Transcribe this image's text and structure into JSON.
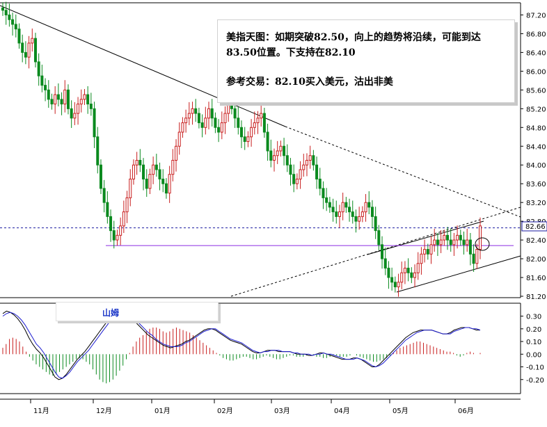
{
  "annotation": {
    "line1": "美指天图：如期突破82.50，向上的趋势将沿续，可能到达83.50位置。下支持在82.10",
    "line2": "参考交易：82.10买入美元，沽出非美"
  },
  "indicator_label": "山姆",
  "chart_data": [
    {
      "type": "candlestick",
      "title": "",
      "xlabel": "",
      "ylabel": "",
      "ylim": [
        81.2,
        87.4
      ],
      "y_ticks": [
        "87.20",
        "86.80",
        "86.40",
        "86.00",
        "85.60",
        "85.20",
        "84.80",
        "84.40",
        "84.00",
        "83.60",
        "83.20",
        "82.80",
        "82.40",
        "82.00",
        "81.60",
        "81.20"
      ],
      "x_ticks": [
        "11月",
        "12月",
        "01月",
        "02月",
        "03月",
        "04月",
        "05月",
        "06月"
      ],
      "current_price": "82.66",
      "horizontal_levels": [
        {
          "value": 82.66,
          "style": "dashed",
          "color": "#1a1aa0"
        },
        {
          "value": 82.28,
          "style": "solid",
          "color": "#8a2be2"
        }
      ],
      "closes": [
        87.3,
        87.2,
        87.1,
        87.0,
        86.9,
        86.6,
        86.4,
        86.3,
        86.6,
        86.7,
        86.2,
        85.9,
        85.7,
        85.6,
        85.4,
        85.3,
        85.5,
        85.4,
        85.3,
        85.6,
        85.2,
        85.0,
        85.1,
        85.3,
        85.4,
        85.5,
        85.3,
        85.2,
        84.6,
        84.0,
        83.5,
        83.2,
        82.9,
        82.6,
        82.4,
        82.5,
        82.7,
        83.0,
        83.3,
        83.7,
        84.0,
        84.1,
        84.0,
        83.7,
        83.5,
        83.8,
        84.0,
        83.9,
        83.7,
        83.6,
        83.4,
        83.8,
        84.1,
        84.4,
        84.7,
        84.9,
        85.0,
        85.1,
        85.2,
        85.1,
        84.9,
        84.8,
        85.0,
        85.2,
        85.0,
        84.8,
        84.7,
        84.9,
        85.1,
        85.3,
        85.2,
        85.0,
        84.8,
        84.6,
        84.5,
        84.6,
        84.8,
        84.9,
        85.0,
        85.1,
        84.7,
        84.3,
        84.1,
        84.2,
        84.3,
        84.4,
        84.2,
        84.0,
        83.8,
        83.6,
        83.7,
        83.9,
        84.0,
        84.1,
        84.2,
        84.0,
        83.7,
        83.5,
        83.3,
        83.2,
        83.1,
        83.0,
        82.9,
        83.0,
        83.2,
        83.1,
        83.0,
        82.9,
        82.8,
        82.9,
        83.0,
        83.2,
        83.1,
        82.9,
        82.6,
        82.3,
        82.0,
        81.8,
        81.6,
        81.5,
        81.4,
        81.5,
        81.7,
        81.8,
        81.7,
        81.6,
        81.7,
        81.9,
        82.1,
        82.2,
        82.1,
        82.3,
        82.4,
        82.3,
        82.4,
        82.5,
        82.4,
        82.3,
        82.4,
        82.5,
        82.4,
        82.3,
        82.4,
        82.1,
        81.9,
        82.2,
        82.7
      ]
    },
    {
      "type": "line",
      "title": "",
      "ylim": [
        -0.3,
        0.38
      ],
      "y_ticks": [
        "0.30",
        "0.20",
        "0.10",
        "0.00",
        "-0.10",
        "-0.20"
      ],
      "histogram": [
        0.05,
        0.08,
        0.12,
        0.13,
        0.12,
        0.1,
        0.06,
        0.02,
        -0.02,
        -0.05,
        -0.08,
        -0.1,
        -0.12,
        -0.14,
        -0.16,
        -0.17,
        -0.16,
        -0.14,
        -0.12,
        -0.1,
        -0.08,
        -0.06,
        -0.04,
        -0.03,
        -0.04,
        -0.06,
        -0.08,
        -0.12,
        -0.16,
        -0.2,
        -0.22,
        -0.23,
        -0.22,
        -0.2,
        -0.17,
        -0.13,
        -0.09,
        -0.04,
        0.01,
        0.06,
        0.1,
        0.13,
        0.15,
        0.18,
        0.2,
        0.21,
        0.21,
        0.2,
        0.18,
        0.17,
        0.18,
        0.2,
        0.21,
        0.2,
        0.19,
        0.18,
        0.17,
        0.15,
        0.13,
        0.11,
        0.09,
        0.07,
        0.05,
        0.03,
        0.01,
        -0.01,
        -0.03,
        -0.04,
        -0.05,
        -0.05,
        -0.04,
        -0.03,
        -0.02,
        -0.02,
        -0.03,
        -0.04,
        -0.04,
        -0.03,
        -0.02,
        -0.01,
        -0.02,
        -0.03,
        -0.04,
        -0.04,
        -0.03,
        -0.02,
        -0.01,
        -0.01,
        -0.02,
        -0.02,
        -0.02,
        -0.01,
        0.0,
        -0.01,
        -0.02,
        -0.02,
        -0.03,
        -0.03,
        -0.02,
        -0.01,
        -0.01,
        -0.02,
        -0.02,
        -0.02,
        -0.01,
        0.0,
        -0.01,
        -0.02,
        -0.03,
        -0.04,
        -0.05,
        -0.06,
        -0.06,
        -0.05,
        -0.04,
        -0.03,
        -0.01,
        0.01,
        0.03,
        0.05,
        0.06,
        0.07,
        0.08,
        0.09,
        0.1,
        0.1,
        0.09,
        0.08,
        0.07,
        0.06,
        0.05,
        0.04,
        0.03,
        0.02,
        0.02,
        0.01,
        -0.01,
        -0.02,
        -0.01,
        0.01,
        0.02,
        0.01,
        0.0,
        0.01
      ],
      "series": [
        {
          "color": "#000000",
          "values": [
            0.32,
            0.34,
            0.33,
            0.31,
            0.28,
            0.24,
            0.19,
            0.13,
            0.08,
            0.04,
            0.01,
            -0.03,
            -0.08,
            -0.13,
            -0.18,
            -0.2,
            -0.19,
            -0.16,
            -0.12,
            -0.08,
            -0.04,
            -0.01,
            0.02,
            0.06,
            0.1,
            0.14,
            0.18,
            0.22,
            0.26,
            0.29,
            0.31,
            0.32,
            0.32,
            0.31,
            0.29,
            0.27,
            0.24,
            0.21,
            0.18,
            0.15,
            0.13,
            0.11,
            0.09,
            0.07,
            0.06,
            0.05,
            0.06,
            0.07,
            0.08,
            0.1,
            0.11,
            0.13,
            0.15,
            0.17,
            0.19,
            0.2,
            0.2,
            0.19,
            0.17,
            0.15,
            0.13,
            0.11,
            0.1,
            0.09,
            0.08,
            0.06,
            0.04,
            0.02,
            0.01,
            0.01,
            0.02,
            0.03,
            0.03,
            0.03,
            0.02,
            0.02,
            0.02,
            0.02,
            0.01,
            0.0,
            0.0,
            0.0,
            -0.01,
            -0.01,
            0.0,
            0.01,
            0.01,
            0.0,
            -0.01,
            -0.02,
            -0.03,
            -0.04,
            -0.04,
            -0.04,
            -0.03,
            -0.03,
            -0.04,
            -0.06,
            -0.08,
            -0.1,
            -0.1,
            -0.08,
            -0.05,
            -0.02,
            0.01,
            0.04,
            0.07,
            0.1,
            0.13,
            0.15,
            0.17,
            0.18,
            0.19,
            0.19,
            0.19,
            0.19,
            0.18,
            0.17,
            0.16,
            0.16,
            0.17,
            0.19,
            0.2,
            0.21,
            0.21,
            0.21,
            0.2,
            0.19,
            0.19
          ]
        },
        {
          "color": "#1a1ad0",
          "values": [
            0.3,
            0.32,
            0.33,
            0.32,
            0.3,
            0.27,
            0.23,
            0.18,
            0.13,
            0.08,
            0.05,
            0.01,
            -0.04,
            -0.09,
            -0.14,
            -0.18,
            -0.19,
            -0.17,
            -0.14,
            -0.1,
            -0.06,
            -0.03,
            0.0,
            0.03,
            0.07,
            0.11,
            0.15,
            0.19,
            0.23,
            0.27,
            0.3,
            0.31,
            0.32,
            0.32,
            0.31,
            0.29,
            0.26,
            0.23,
            0.2,
            0.17,
            0.15,
            0.12,
            0.1,
            0.08,
            0.07,
            0.06,
            0.06,
            0.06,
            0.07,
            0.09,
            0.1,
            0.12,
            0.14,
            0.16,
            0.18,
            0.19,
            0.2,
            0.2,
            0.18,
            0.16,
            0.14,
            0.12,
            0.11,
            0.1,
            0.09,
            0.07,
            0.05,
            0.03,
            0.02,
            0.01,
            0.02,
            0.02,
            0.03,
            0.03,
            0.03,
            0.02,
            0.02,
            0.02,
            0.01,
            0.01,
            0.0,
            0.0,
            0.0,
            -0.01,
            0.0,
            0.0,
            0.01,
            0.0,
            0.0,
            -0.01,
            -0.02,
            -0.03,
            -0.04,
            -0.04,
            -0.04,
            -0.03,
            -0.04,
            -0.05,
            -0.07,
            -0.09,
            -0.1,
            -0.09,
            -0.07,
            -0.04,
            -0.01,
            0.02,
            0.05,
            0.08,
            0.11,
            0.13,
            0.15,
            0.17,
            0.18,
            0.19,
            0.19,
            0.19,
            0.18,
            0.17,
            0.16,
            0.16,
            0.16,
            0.18,
            0.19,
            0.2,
            0.21,
            0.21,
            0.2,
            0.2,
            0.19
          ]
        }
      ]
    }
  ]
}
